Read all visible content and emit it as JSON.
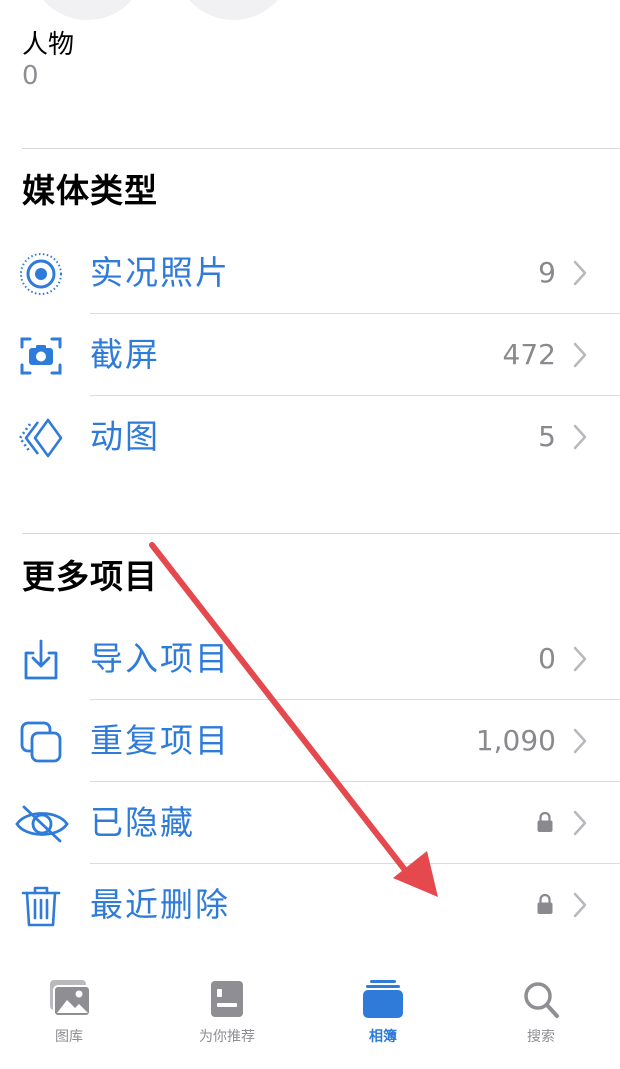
{
  "people": {
    "label": "人物",
    "count": "0"
  },
  "media_types": {
    "title": "媒体类型",
    "items": [
      {
        "icon": "live-photo-icon",
        "label": "实况照片",
        "count": "9"
      },
      {
        "icon": "screenshot-icon",
        "label": "截屏",
        "count": "472"
      },
      {
        "icon": "animated-icon",
        "label": "动图",
        "count": "5"
      }
    ]
  },
  "more_items": {
    "title": "更多项目",
    "items": [
      {
        "icon": "import-icon",
        "label": "导入项目",
        "count": "0"
      },
      {
        "icon": "duplicate-icon",
        "label": "重复项目",
        "count": "1,090"
      },
      {
        "icon": "hidden-eye-icon",
        "label": "已隐藏",
        "locked": true
      },
      {
        "icon": "trash-icon",
        "label": "最近删除",
        "locked": true
      }
    ]
  },
  "tabbar": {
    "tabs": [
      {
        "icon": "library-icon",
        "label": "图库"
      },
      {
        "icon": "for-you-icon",
        "label": "为你推荐"
      },
      {
        "icon": "albums-icon",
        "label": "相簿",
        "active": true
      },
      {
        "icon": "search-icon",
        "label": "搜索"
      }
    ]
  },
  "colors": {
    "accent": "#2f7bd9",
    "secondary_text": "#8a8a8e",
    "annotation_arrow": "#e5484d"
  }
}
